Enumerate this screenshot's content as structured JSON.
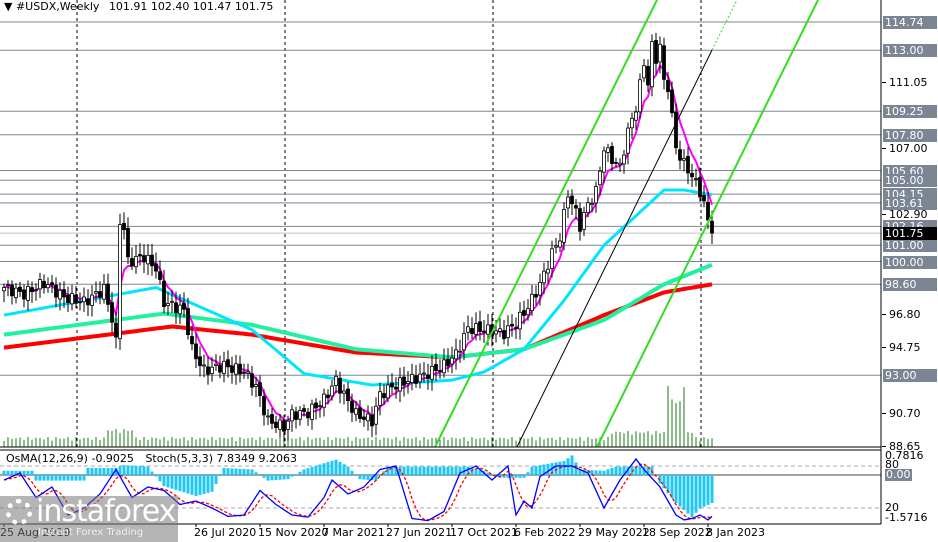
{
  "header": {
    "symbol": "#USDX,Weekly",
    "ohlc": "101.91 102.40 101.47 101.75"
  },
  "indicator_header": {
    "osma": "OsMA(12,26,9) -0.9025",
    "stoch": "Stoch(5,3,3) 7.8349 9.2063"
  },
  "logo": {
    "name": "instaforex",
    "tagline": "Instant Forex Trading"
  },
  "colors": {
    "bull": "#ffffff",
    "bear": "#000000",
    "ma_fast": "#ff00ff",
    "ma_mid": "#00e5ff",
    "ma_slow": "#20f0a0",
    "ma_long": "#ff0000",
    "channel": "#33dd22",
    "level_line": "#7b8594",
    "osma": "#1ec8f5",
    "stoch_main": "#0000ff",
    "stoch_signal": "#ff0000",
    "volume": "#1a7a1a"
  },
  "chart_data": {
    "type": "candlestick",
    "title": "#USDX,Weekly",
    "ylim": [
      88.65,
      115.15
    ],
    "current_price": "101.75",
    "level_labels": [
      "114.74",
      "113.00",
      "109.25",
      "107.80",
      "105.60",
      "105.00",
      "104.15",
      "103.61",
      "102.16",
      "101.00",
      "100.00",
      "98.60",
      "93.00"
    ],
    "tick_labels": [
      "111.05",
      "107.00",
      "102.90",
      "96.80",
      "94.75",
      "90.70",
      "88.65"
    ],
    "date_labels": [
      {
        "text": "25 Aug 2019",
        "week": 0
      },
      {
        "text": "26 Jul 2020",
        "week": 48
      },
      {
        "text": "15 Nov 2020",
        "week": 64
      },
      {
        "text": "7 Mar 2021",
        "week": 80
      },
      {
        "text": "27 Jun 2021",
        "week": 96
      },
      {
        "text": "17 Oct 2021",
        "week": 112
      },
      {
        "text": "6 Feb 2022",
        "week": 128
      },
      {
        "text": "29 May 2022",
        "week": 144
      },
      {
        "text": "18 Sep 2022",
        "week": 160
      },
      {
        "text": "8 Jan 2023",
        "week": 176
      }
    ],
    "weeks": 178,
    "close_anchors": [
      [
        0,
        98.4
      ],
      [
        5,
        98.0
      ],
      [
        10,
        98.7
      ],
      [
        15,
        97.8
      ],
      [
        20,
        97.5
      ],
      [
        25,
        98.3
      ],
      [
        27,
        96.5
      ],
      [
        28,
        95.0
      ],
      [
        29,
        102.5
      ],
      [
        30,
        102.0
      ],
      [
        31,
        100.0
      ],
      [
        35,
        100.3
      ],
      [
        38,
        99.6
      ],
      [
        40,
        97.5
      ],
      [
        45,
        97.0
      ],
      [
        47,
        94.6
      ],
      [
        50,
        93.3
      ],
      [
        55,
        93.6
      ],
      [
        60,
        93.2
      ],
      [
        63,
        92.3
      ],
      [
        66,
        90.2
      ],
      [
        70,
        89.8
      ],
      [
        72,
        90.6
      ],
      [
        76,
        90.7
      ],
      [
        80,
        91.5
      ],
      [
        83,
        92.7
      ],
      [
        85,
        91.8
      ],
      [
        88,
        90.6
      ],
      [
        92,
        90.2
      ],
      [
        94,
        91.8
      ],
      [
        97,
        92.3
      ],
      [
        100,
        92.6
      ],
      [
        105,
        93.0
      ],
      [
        110,
        93.6
      ],
      [
        113,
        94.3
      ],
      [
        116,
        95.9
      ],
      [
        120,
        95.8
      ],
      [
        125,
        95.6
      ],
      [
        128,
        96.2
      ],
      [
        131,
        97.2
      ],
      [
        134,
        98.6
      ],
      [
        137,
        100.5
      ],
      [
        139,
        101.5
      ],
      [
        141,
        104.2
      ],
      [
        143,
        103.0
      ],
      [
        144,
        102.2
      ],
      [
        146,
        103.5
      ],
      [
        148,
        104.3
      ],
      [
        150,
        107.0
      ],
      [
        152,
        106.3
      ],
      [
        154,
        105.8
      ],
      [
        156,
        108.0
      ],
      [
        158,
        109.5
      ],
      [
        160,
        112.2
      ],
      [
        161,
        111.0
      ],
      [
        162,
        113.2
      ],
      [
        163,
        112.5
      ],
      [
        164,
        113.3
      ],
      [
        165,
        111.0
      ],
      [
        166,
        110.8
      ],
      [
        168,
        107.0
      ],
      [
        170,
        106.0
      ],
      [
        172,
        105.3
      ],
      [
        174,
        104.3
      ],
      [
        175,
        103.6
      ],
      [
        176,
        102.4
      ],
      [
        177,
        101.75
      ]
    ],
    "ma_mid": [
      [
        0,
        96.7
      ],
      [
        38,
        98.4
      ],
      [
        62,
        95.8
      ],
      [
        75,
        93.1
      ],
      [
        92,
        92.4
      ],
      [
        112,
        92.7
      ],
      [
        120,
        93.2
      ],
      [
        130,
        94.6
      ],
      [
        140,
        97.6
      ],
      [
        150,
        101
      ],
      [
        165,
        104.4
      ],
      [
        170,
        104.4
      ],
      [
        177,
        104.1
      ]
    ],
    "ma_slow": [
      [
        0,
        95.5
      ],
      [
        40,
        96.8
      ],
      [
        62,
        96.1
      ],
      [
        88,
        94.6
      ],
      [
        112,
        94.1
      ],
      [
        130,
        94.6
      ],
      [
        150,
        96.4
      ],
      [
        165,
        98.6
      ],
      [
        177,
        99.8
      ]
    ],
    "ma_long": [
      [
        0,
        94.7
      ],
      [
        42,
        96
      ],
      [
        62,
        95.5
      ],
      [
        88,
        94.4
      ],
      [
        112,
        94.1
      ],
      [
        130,
        94.6
      ],
      [
        150,
        96.7
      ],
      [
        165,
        98.1
      ],
      [
        177,
        98.6
      ]
    ],
    "osma_range": [
      -1.5716,
      0.7816
    ],
    "osma_labels": [
      "0.7816",
      "0.00",
      "-1.5716"
    ],
    "stoch_levels": [
      "80",
      "20"
    ],
    "osma": [
      [
        0,
        0.15
      ],
      [
        7,
        0.15
      ],
      [
        8,
        -0.2
      ],
      [
        20,
        -0.2
      ],
      [
        21,
        0.25
      ],
      [
        28,
        0.25
      ],
      [
        30,
        0.35
      ],
      [
        36,
        0.3
      ],
      [
        40,
        -0.4
      ],
      [
        48,
        -0.75
      ],
      [
        52,
        -0.6
      ],
      [
        55,
        0.25
      ],
      [
        62,
        0.2
      ],
      [
        66,
        -0.2
      ],
      [
        71,
        -0.15
      ],
      [
        75,
        0.2
      ],
      [
        83,
        0.55
      ],
      [
        86,
        0.3
      ],
      [
        89,
        -0.15
      ],
      [
        93,
        -0.2
      ],
      [
        96,
        0.3
      ],
      [
        116,
        0.3
      ],
      [
        120,
        0.15
      ],
      [
        124,
        -0.1
      ],
      [
        130,
        -0.1
      ],
      [
        132,
        0.3
      ],
      [
        140,
        0.5
      ],
      [
        142,
        0.7
      ],
      [
        144,
        0.2
      ],
      [
        150,
        0.15
      ],
      [
        153,
        0.3
      ],
      [
        162,
        0.3
      ],
      [
        164,
        -0.3
      ],
      [
        168,
        -1.0
      ],
      [
        172,
        -1.5
      ],
      [
        174,
        -1.2
      ],
      [
        177,
        -1.0
      ]
    ],
    "stoch_main": [
      [
        0,
        60
      ],
      [
        4,
        70
      ],
      [
        8,
        35
      ],
      [
        12,
        50
      ],
      [
        16,
        10
      ],
      [
        20,
        20
      ],
      [
        24,
        40
      ],
      [
        28,
        75
      ],
      [
        32,
        35
      ],
      [
        36,
        50
      ],
      [
        40,
        45
      ],
      [
        44,
        25
      ],
      [
        48,
        30
      ],
      [
        52,
        20
      ],
      [
        56,
        8
      ],
      [
        60,
        10
      ],
      [
        64,
        45
      ],
      [
        68,
        25
      ],
      [
        72,
        10
      ],
      [
        76,
        7
      ],
      [
        80,
        35
      ],
      [
        82,
        60
      ],
      [
        86,
        40
      ],
      [
        90,
        50
      ],
      [
        94,
        75
      ],
      [
        98,
        80
      ],
      [
        102,
        5
      ],
      [
        106,
        2
      ],
      [
        110,
        15
      ],
      [
        114,
        70
      ],
      [
        118,
        80
      ],
      [
        122,
        60
      ],
      [
        126,
        80
      ],
      [
        128,
        10
      ],
      [
        130,
        30
      ],
      [
        132,
        20
      ],
      [
        134,
        65
      ],
      [
        138,
        80
      ],
      [
        142,
        80
      ],
      [
        146,
        70
      ],
      [
        150,
        20
      ],
      [
        154,
        60
      ],
      [
        156,
        75
      ],
      [
        158,
        90
      ],
      [
        160,
        75
      ],
      [
        164,
        50
      ],
      [
        166,
        30
      ],
      [
        168,
        10
      ],
      [
        170,
        3
      ],
      [
        172,
        5
      ],
      [
        174,
        10
      ],
      [
        176,
        3
      ],
      [
        177,
        8
      ]
    ]
  }
}
